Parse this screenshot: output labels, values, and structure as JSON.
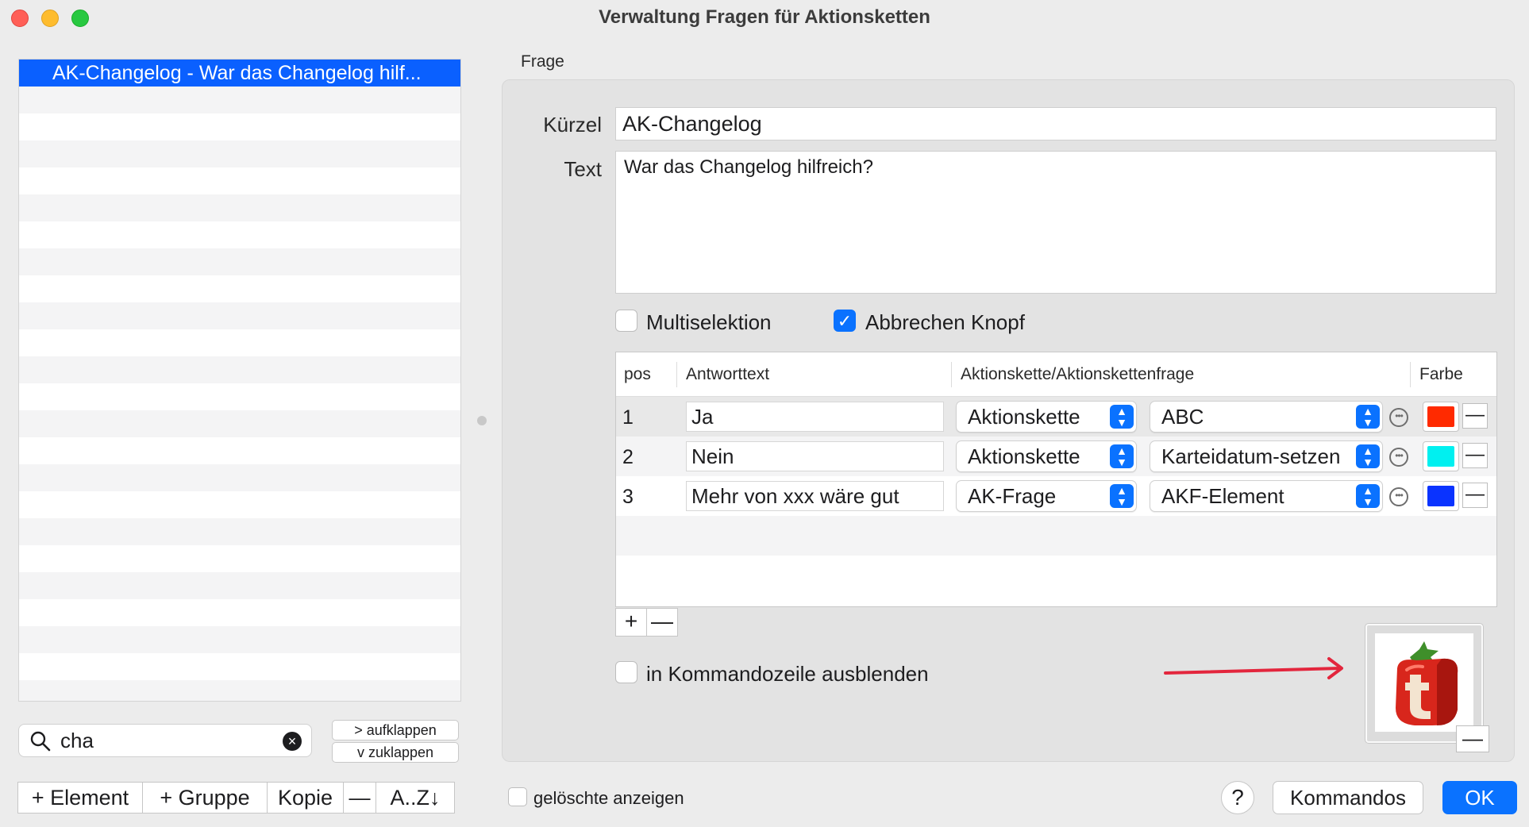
{
  "window": {
    "title": "Verwaltung Fragen für Aktionsketten"
  },
  "list": {
    "items": [
      "AK-Changelog - War das Changelog hilf..."
    ]
  },
  "search": {
    "value": "cha",
    "clear_icon": "×"
  },
  "expand": {
    "open_label": "> aufklappen",
    "close_label": "v  zuklappen"
  },
  "bottom_buttons": {
    "add_element": "+ Element",
    "add_group": "+ Gruppe",
    "copy": "Kopie",
    "remove": "—",
    "sort": "A..Z↓"
  },
  "frage": {
    "section_label": "Frage",
    "kuerzel_label": "Kürzel",
    "kuerzel_value": "AK-Changelog",
    "text_label": "Text",
    "text_value": "War das Changelog hilfreich?",
    "multiselektion_label": "Multiselektion",
    "multiselektion_checked": false,
    "abbrechen_label": "Abbrechen Knopf",
    "abbrechen_checked": true,
    "kommandozeile_label": "in Kommandozeile ausblenden",
    "kommandozeile_checked": false
  },
  "table": {
    "headers": [
      "pos",
      "Antworttext",
      "Aktionskette/Aktionskettenfrage",
      "Farbe"
    ],
    "rows": [
      {
        "pos": "1",
        "answer": "Ja",
        "type": "Aktionskette",
        "target": "ABC",
        "color": "#ff2a00"
      },
      {
        "pos": "2",
        "answer": "Nein",
        "type": "Aktionskette",
        "target": "Karteidatum-setzen",
        "color": "#00f0f0"
      },
      {
        "pos": "3",
        "answer": "Mehr von xxx wäre gut",
        "type": "AK-Frage",
        "target": "AKF-Element",
        "color": "#0a33ff"
      }
    ],
    "add_row": "+",
    "remove_row": "—",
    "remove_icon": "—"
  },
  "image": {
    "remove": "—"
  },
  "footer": {
    "show_deleted_label": "gelöschte anzeigen",
    "show_deleted_checked": false,
    "help": "?",
    "kommandos": "Kommandos",
    "ok": "OK"
  }
}
